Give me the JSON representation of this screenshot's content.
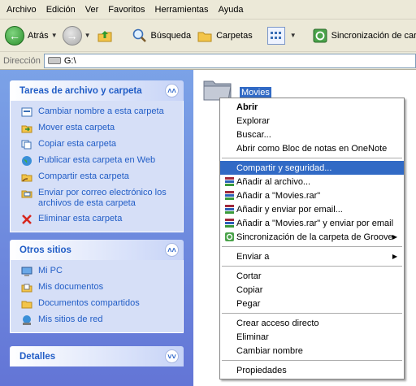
{
  "menubar": [
    "Archivo",
    "Edición",
    "Ver",
    "Favoritos",
    "Herramientas",
    "Ayuda"
  ],
  "toolbar": {
    "back_label": "Atrás",
    "search_label": "Búsqueda",
    "folders_label": "Carpetas",
    "sync_label": "Sincronización de car"
  },
  "address": {
    "label": "Dirección",
    "value": "G:\\"
  },
  "tasks_panel": {
    "title": "Tareas de archivo y carpeta",
    "items": [
      {
        "label": "Cambiar nombre a esta carpeta",
        "icon": "rename-icon"
      },
      {
        "label": "Mover esta carpeta",
        "icon": "move-icon"
      },
      {
        "label": "Copiar esta carpeta",
        "icon": "copy-icon"
      },
      {
        "label": "Publicar esta carpeta en Web",
        "icon": "globe-icon"
      },
      {
        "label": "Compartir esta carpeta",
        "icon": "share-icon"
      },
      {
        "label": "Enviar por correo electrónico los archivos de esta carpeta",
        "icon": "mail-icon"
      },
      {
        "label": "Eliminar esta carpeta",
        "icon": "delete-icon"
      }
    ]
  },
  "other_places": {
    "title": "Otros sitios",
    "items": [
      {
        "label": "Mi PC",
        "icon": "computer-icon"
      },
      {
        "label": "Mis documentos",
        "icon": "documents-icon"
      },
      {
        "label": "Documentos compartidos",
        "icon": "shared-folder-icon"
      },
      {
        "label": "Mis sitios de red",
        "icon": "network-icon"
      }
    ]
  },
  "details": {
    "title": "Detalles"
  },
  "folder": {
    "name": "Movies"
  },
  "context_menu": {
    "open": "Abrir",
    "explore": "Explorar",
    "search": "Buscar...",
    "onenote": "Abrir como Bloc de notas en OneNote",
    "sharing": "Compartir y seguridad...",
    "add_archive": "Añadir al archivo...",
    "add_rar": "Añadir a \"Movies.rar\"",
    "add_email": "Añadir y enviar por email...",
    "add_rar_email": "Añadir a \"Movies.rar\" y enviar por email",
    "groove_sync": "Sincronización de la carpeta de Groove",
    "send_to": "Enviar a",
    "cut": "Cortar",
    "copy": "Copiar",
    "paste": "Pegar",
    "shortcut": "Crear acceso directo",
    "delete": "Eliminar",
    "rename": "Cambiar nombre",
    "properties": "Propiedades"
  },
  "colors": {
    "highlight": "#316ac5",
    "task_link": "#215dc6",
    "pane": "#7ba2e7"
  }
}
